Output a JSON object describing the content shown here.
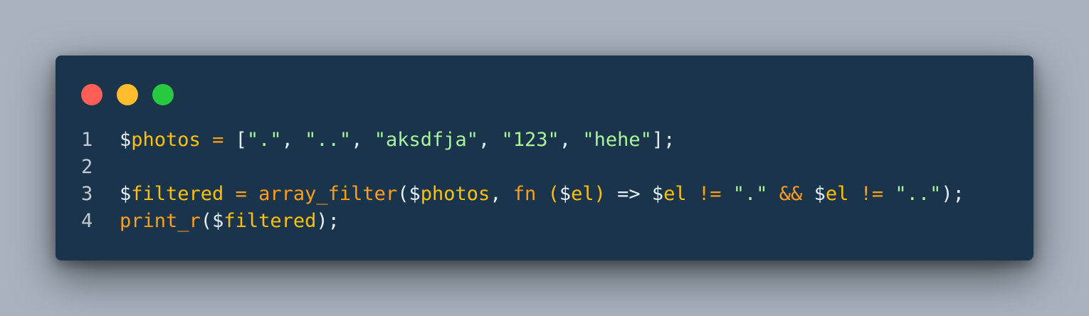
{
  "window": {
    "colors": {
      "background": "#1a344b",
      "close": "#ff5f56",
      "minimize": "#ffbd2e",
      "maximize": "#27c93f"
    }
  },
  "syntax_colors": {
    "plain": "#e6eef5",
    "var": "#ffc107",
    "op": "#ff9f1a",
    "str": "#a8f59c",
    "fn": "#ff9f1a"
  },
  "code": {
    "lines": [
      {
        "number": "1",
        "tokens": [
          {
            "t": "$",
            "c": "plain"
          },
          {
            "t": "photos",
            "c": "var"
          },
          {
            "t": " ",
            "c": "plain"
          },
          {
            "t": "=",
            "c": "op"
          },
          {
            "t": " [",
            "c": "plain"
          },
          {
            "t": "\".\"",
            "c": "str"
          },
          {
            "t": ", ",
            "c": "plain"
          },
          {
            "t": "\"..\"",
            "c": "str"
          },
          {
            "t": ", ",
            "c": "plain"
          },
          {
            "t": "\"aksdfja\"",
            "c": "str"
          },
          {
            "t": ", ",
            "c": "plain"
          },
          {
            "t": "\"123\"",
            "c": "str"
          },
          {
            "t": ", ",
            "c": "plain"
          },
          {
            "t": "\"hehe\"",
            "c": "str"
          },
          {
            "t": "];",
            "c": "plain"
          }
        ]
      },
      {
        "number": "2",
        "tokens": []
      },
      {
        "number": "3",
        "tokens": [
          {
            "t": "$",
            "c": "plain"
          },
          {
            "t": "filtered",
            "c": "var"
          },
          {
            "t": " ",
            "c": "plain"
          },
          {
            "t": "=",
            "c": "op"
          },
          {
            "t": " ",
            "c": "plain"
          },
          {
            "t": "array_filter",
            "c": "fn"
          },
          {
            "t": "(",
            "c": "plain"
          },
          {
            "t": "$",
            "c": "plain"
          },
          {
            "t": "photos",
            "c": "var"
          },
          {
            "t": ", ",
            "c": "plain"
          },
          {
            "t": "fn",
            "c": "fn"
          },
          {
            "t": " ",
            "c": "plain"
          },
          {
            "t": "(",
            "c": "var"
          },
          {
            "t": "$",
            "c": "plain"
          },
          {
            "t": "el",
            "c": "var"
          },
          {
            "t": ")",
            "c": "var"
          },
          {
            "t": " => ",
            "c": "plain"
          },
          {
            "t": "$",
            "c": "plain"
          },
          {
            "t": "el",
            "c": "var"
          },
          {
            "t": " ",
            "c": "plain"
          },
          {
            "t": "!=",
            "c": "op"
          },
          {
            "t": " ",
            "c": "plain"
          },
          {
            "t": "\".\"",
            "c": "str"
          },
          {
            "t": " ",
            "c": "plain"
          },
          {
            "t": "&&",
            "c": "op"
          },
          {
            "t": " ",
            "c": "plain"
          },
          {
            "t": "$",
            "c": "plain"
          },
          {
            "t": "el",
            "c": "var"
          },
          {
            "t": " ",
            "c": "plain"
          },
          {
            "t": "!=",
            "c": "op"
          },
          {
            "t": " ",
            "c": "plain"
          },
          {
            "t": "\"..\"",
            "c": "str"
          },
          {
            "t": ");",
            "c": "plain"
          }
        ]
      },
      {
        "number": "4",
        "tokens": [
          {
            "t": "print_r",
            "c": "fn"
          },
          {
            "t": "(",
            "c": "plain"
          },
          {
            "t": "$",
            "c": "plain"
          },
          {
            "t": "filtered",
            "c": "var"
          },
          {
            "t": ");",
            "c": "plain"
          }
        ]
      }
    ]
  }
}
